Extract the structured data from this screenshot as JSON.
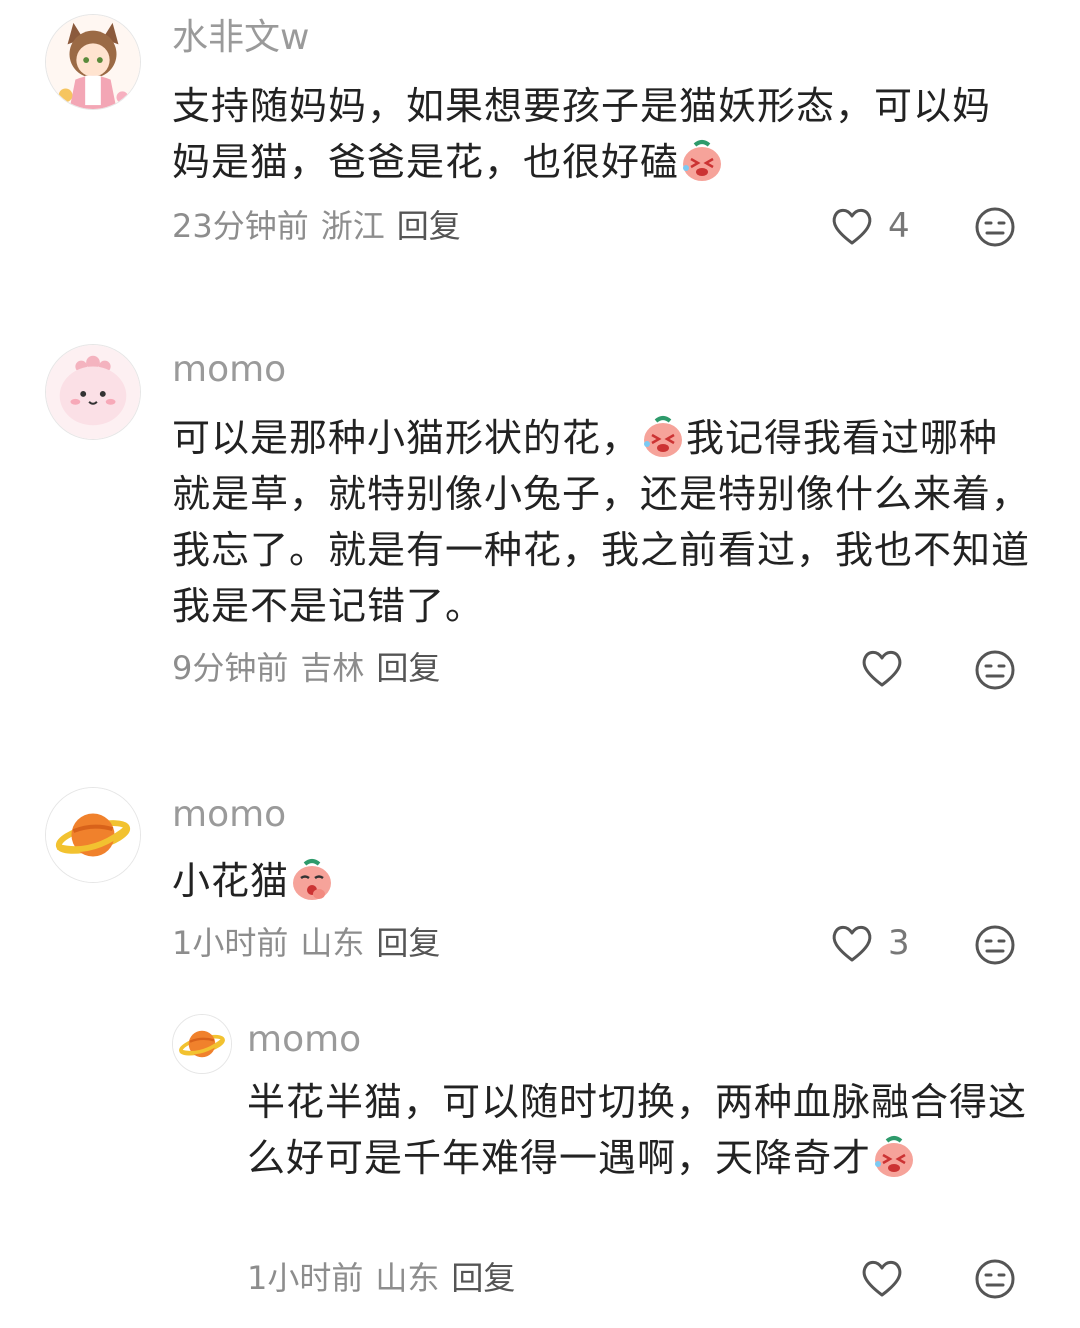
{
  "comments": [
    {
      "username": "水非文w",
      "text_before": "支持随妈妈，如果想要孩子是猫妖形态，可以妈妈是猫，爸爸是花，也很好磕",
      "emoji": "laughing-crying-emoji",
      "text_after": "",
      "time": "23分钟前",
      "location": "浙江",
      "reply": "回复",
      "likes": "4",
      "avatar": "anime-catgirl-avatar"
    },
    {
      "username": "momo",
      "text_before": "可以是那种小猫形状的花，",
      "emoji": "laughing-crying-emoji",
      "text_after": "我记得我看过哪种就是草，就特别像小兔子，还是特别像什么来着，我忘了。就是有一种花，我之前看过，我也不知道我是不是记错了。",
      "time": "9分钟前",
      "location": "吉林",
      "reply": "回复",
      "likes": "",
      "avatar": "pink-blob-avatar"
    },
    {
      "username": "momo",
      "text_before": "小花猫",
      "emoji": "giggle-emoji",
      "text_after": "",
      "time": "1小时前",
      "location": "山东",
      "reply": "回复",
      "likes": "3",
      "avatar": "planet-avatar"
    },
    {
      "username": "momo",
      "text_before": "半花半猫，可以随时切换，两种血脉融合得这么好可是千年难得一遇啊，天降奇才",
      "emoji": "laughing-crying-emoji",
      "text_after": "",
      "time": "1小时前",
      "location": "山东",
      "reply": "回复",
      "likes": "",
      "avatar": "planet-avatar"
    }
  ],
  "colors": {
    "text": "#222222",
    "meta": "#8d8d8d",
    "username": "#9a9a9a",
    "emoji": "#f6a39a"
  }
}
